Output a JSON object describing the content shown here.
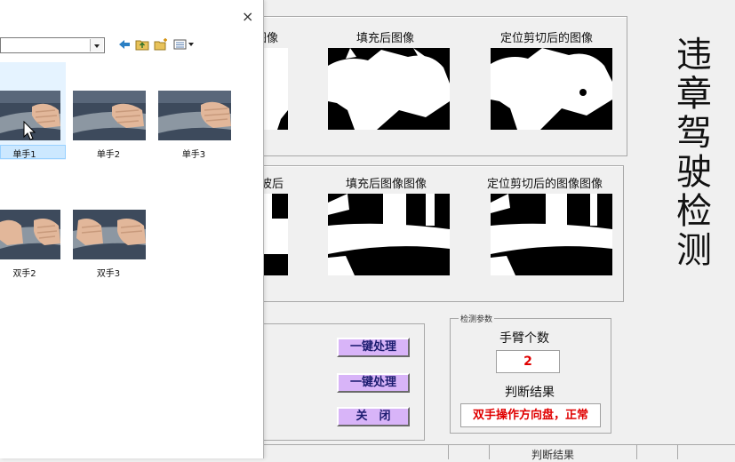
{
  "main": {
    "row1_labels": [
      "图像",
      "填充后图像",
      "定位剪切后的图像"
    ],
    "row2_labels": [
      "波后",
      "填充后图像图像",
      "定位剪切后的图像图像"
    ],
    "side_title": [
      "违",
      "章",
      "驾",
      "驶",
      "检",
      "测"
    ],
    "buttons": {
      "process1": "一键处理",
      "process2": "一键处理",
      "close": "关　闭"
    },
    "params": {
      "group_caption": "检测参数",
      "arm_count_label": "手臂个数",
      "arm_count_value": "2",
      "result_label": "判断结果",
      "result_value": "双手操作方向盘，正常"
    },
    "bottom_cut_text": "判断结果",
    "accent_colors": {
      "button_bg": "#d8b4f8",
      "value_red": "#e00000"
    }
  },
  "dialog": {
    "close_glyph": "×",
    "files": [
      {
        "name": "单手1",
        "selected": true
      },
      {
        "name": "单手2",
        "selected": false
      },
      {
        "name": "单手3",
        "selected": false
      },
      {
        "name": "双手2",
        "selected": false
      },
      {
        "name": "双手3",
        "selected": false
      }
    ],
    "toolbar_icons": [
      "back-arrow-icon",
      "up-folder-icon",
      "new-folder-icon",
      "view-menu-icon"
    ]
  }
}
